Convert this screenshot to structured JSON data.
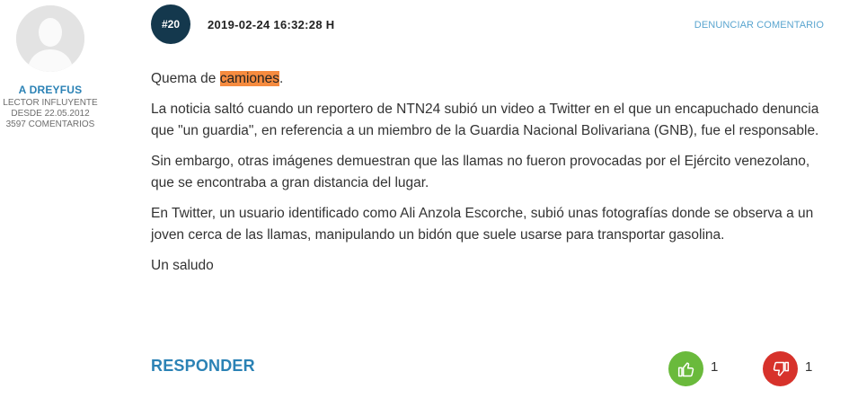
{
  "user": {
    "name": "A DREYFUS",
    "rank": "LECTOR INFLUYENTE",
    "since": "DESDE 22.05.2012",
    "comments": "3597 COMENTARIOS"
  },
  "comment": {
    "number": "#20",
    "date": "2019-02-24 16:32:28 H",
    "report_label": "DENUNCIAR COMENTARIO",
    "line1_prefix": "Quema de ",
    "line1_highlight": "camiones",
    "line1_suffix": ".",
    "paragraphs": [
      "La noticia saltó cuando un reportero de NTN24 subió un video a Twitter en el que un encapuchado denuncia que \"un guardia\", en referencia a un miembro de la Guardia Nacional Bolivariana (GNB), fue el responsable.",
      "Sin embargo, otras imágenes demuestran que las llamas no fueron provocadas por el Ejército venezolano, que se encontraba a gran distancia del lugar.",
      "En Twitter, un usuario identificado como Ali Anzola Escorche, subió unas fotografías donde se observa a un joven cerca de las llamas, manipulando un bidón que suele usarse para transportar gasolina.",
      "Un saludo"
    ]
  },
  "actions": {
    "reply_label": "RESPONDER",
    "likes": "1",
    "dislikes": "1"
  },
  "icons": {
    "like": "thumbs-up-icon",
    "dislike": "thumbs-down-icon",
    "avatar": "default-user-silhouette"
  },
  "colors": {
    "link_blue": "#2b82b5",
    "badge_navy": "#14384d",
    "highlight_orange": "#f68b3f",
    "like_green": "#6aba3c",
    "dislike_red": "#d7322b"
  }
}
